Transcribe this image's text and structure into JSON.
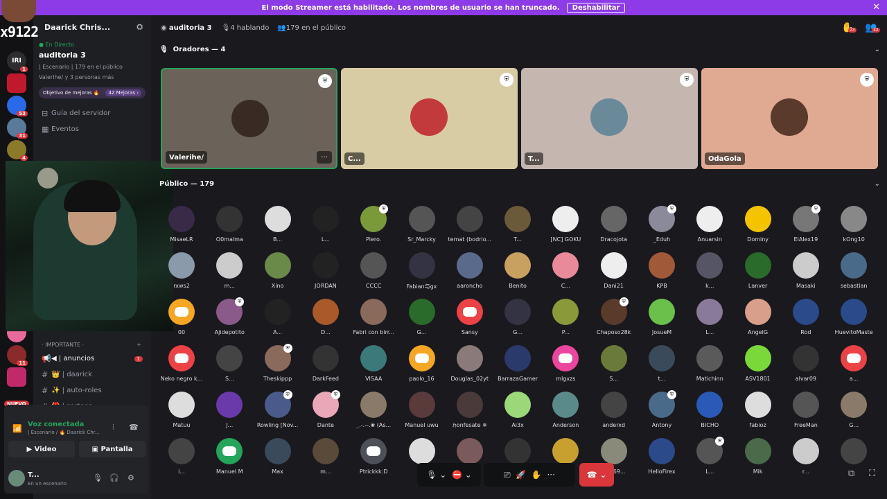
{
  "banner": {
    "text": "El modo Streamer está habilitado. Los nombres de usuario se han truncado.",
    "button": "Deshabilitar",
    "close": "✕"
  },
  "overlay": {
    "name": "x9122"
  },
  "server": {
    "name": "Daarick Chris...",
    "invite_icon": "user-plus-icon"
  },
  "rail": {
    "badges": [
      "1",
      "53",
      "31",
      "4",
      "11"
    ],
    "new_label": "NUEVO"
  },
  "live": {
    "status": "En Directo",
    "stage": "auditoria 3",
    "info": "| Escenario | 179 en el público",
    "people": "Valerihe/ y 3 personas más"
  },
  "goal": {
    "label": "Objetivo de mejoras 🔥",
    "count": "42 Mejoras ›"
  },
  "channels_top": [
    {
      "name": "Guía del servidor",
      "icon": "⊟"
    },
    {
      "name": "Eventos",
      "icon": "▦"
    }
  ],
  "category": {
    "name": "· IMPORTANTE ·",
    "plus": "+"
  },
  "channels": [
    {
      "name": "anuncios",
      "prefix": "◀ |",
      "icon": "📢",
      "badge": "1"
    },
    {
      "name": "daarick",
      "prefix": "👑 |",
      "icon": "#"
    },
    {
      "name": "auto-roles",
      "prefix": "✨ |",
      "icon": "#"
    },
    {
      "name": "sorteos",
      "prefix": "🎁 |",
      "icon": "#"
    }
  ],
  "voice": {
    "status": "Voz conectada",
    "location": "| Escenario / 🔥 Daarick Chr...",
    "video": "Video",
    "screen": "Pantalla"
  },
  "user": {
    "name": "T...",
    "status": "En un escenario"
  },
  "header": {
    "stage": "auditoria 3",
    "speaking": "4 hablando",
    "audience": "179 en el público",
    "hand_badge": "23",
    "people_badge": "32"
  },
  "speakers_title": "Oradores — 4",
  "audience_title": "Público — 179",
  "speakers": [
    {
      "name": "Valerihe/",
      "bg": "#6b6359",
      "av": "#3a2a24",
      "border": "#23a55a"
    },
    {
      "name": "C...",
      "bg": "#d8cca4",
      "av": "#c33a3a",
      "border": "none"
    },
    {
      "name": "T...",
      "bg": "#c6b6b0",
      "av": "#6a8a9a",
      "border": "none"
    },
    {
      "name": "OdaGola",
      "bg": "#e0aa92",
      "av": "#5a3a2a",
      "border": "none"
    }
  ],
  "audience": [
    [
      "MisaeLR",
      "O0malma",
      "B...",
      "L...",
      "Piero.",
      "Sr_Marcky",
      "temat (bodrio...",
      "T...",
      "[NC] GOKU",
      "Dracojota",
      "_Eduh",
      "Anuarsin",
      "Dominy",
      "ElAlex19",
      "kOng10"
    ],
    [
      "rxws2",
      "m...",
      "Xino",
      "JORDAN",
      "CCCC",
      "Fabian与gx",
      "aaroncho",
      "Benito",
      "C...",
      "Dani21",
      "KPB",
      "k...",
      "Lanver",
      "Masaki",
      "sebastian"
    ],
    [
      "00",
      "Ajidepotito",
      "A...",
      "D...",
      "Fabri con birr...",
      "G...",
      "Sansy",
      "G...",
      "P...",
      "Chaposo28k",
      "JosueM",
      "L...",
      "AngelG",
      "Rod",
      "HuevitoMaste"
    ],
    [
      "Neko negro k...",
      "S...",
      "Theskippp",
      "DarkFeed",
      "VISAA",
      "paolo_16",
      "Douglas_02yt",
      "BarrazaGamer",
      "mlgxzs",
      "S...",
      "t...",
      "Matichinn",
      "ASV1801",
      "alvar09",
      "a..."
    ],
    [
      "Matuu",
      "J...",
      "Rowling [Nov...",
      "Dante",
      "_.-.--.❀ (As...",
      "Manuel uwu",
      "ℌonfesate ✵",
      "Ai3x",
      "Anderson",
      "anderxd",
      "Antony",
      "BICHO",
      "fabioz",
      "FreeMan",
      "G..."
    ],
    [
      "i...",
      "Manuel M",
      "Max",
      "m...",
      "Ptrickkk:D",
      "",
      "",
      "",
      "",
      "ℓ...E69...",
      "HelloFirex",
      "L...",
      "Mik",
      "r...",
      ""
    ]
  ],
  "audience_colors": [
    [
      "#3a2a4a",
      "#333",
      "#ddd",
      "#222",
      "#7a9a3a",
      "#555",
      "#444",
      "#6a5a3a",
      "#eee",
      "#666",
      "#8a8a9a",
      "#eee",
      "#f5c400",
      "#777",
      "#888"
    ],
    [
      "#8a9aaa",
      "#ccc",
      "#6a8a4a",
      "#222",
      "#555",
      "#334",
      "#5a6a8a",
      "#c8a060",
      "#e88a9a",
      "#eee",
      "#a05a3a",
      "#556",
      "#2a6a2a",
      "#ccc",
      "#4a6a8a"
    ],
    [
      "#f5a623",
      "#8a5a8a",
      "#222",
      "#aa5a2a",
      "#8a6a5a",
      "#2a6a2a",
      "#ed4245",
      "#334",
      "#8a9a3a",
      "#5a3a2a",
      "#6ac04a",
      "#8a7a9a",
      "#d8a08a",
      "#2a4a8a",
      "#2a4a8a"
    ],
    [
      "#ed4245",
      "#444",
      "#8a6a5a",
      "#333",
      "#3a7a7a",
      "#f5a623",
      "#8a7a7a",
      "#2a3a6a",
      "#eb459e",
      "#6a7a3a",
      "#3a4a5a",
      "#5a5a5a",
      "#7ad83a",
      "#333",
      "#ed4245"
    ],
    [
      "#ddd",
      "#6a3aaa",
      "#4a5a8a",
      "#e8a8b8",
      "#8a7a6a",
      "#5a3a3a",
      "#4a3a3a",
      "#9ad87a",
      "#5a8a8a",
      "#444",
      "#4a6a8a",
      "#2a5ab8",
      "#ddd",
      "#555",
      "#8a7a6a"
    ],
    [
      "#444",
      "#23a55a",
      "#3a4a5a",
      "#5a4a3a",
      "#4e5058",
      "#ddd",
      "#7a5a5a",
      "#333",
      "#c8a030",
      "#8a8a7a",
      "#2a4a8a",
      "#555",
      "#4a6a4a",
      "#ccc",
      "#444"
    ]
  ],
  "controls": {
    "mic": "🎙",
    "camera": "⛔",
    "share": "⎚",
    "activity": "🚀",
    "hand": "✋",
    "more": "···",
    "leave": "☎"
  }
}
